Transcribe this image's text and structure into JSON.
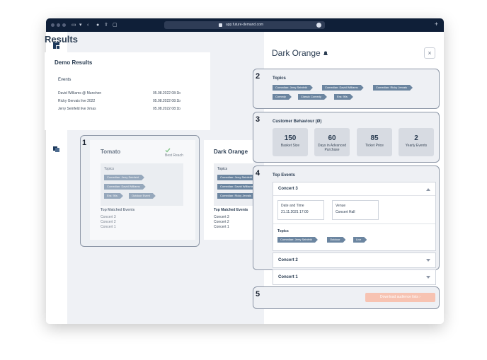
{
  "browser": {
    "url": "app.future-demand.com"
  },
  "sidebar": {
    "icons": [
      "brand-logo-icon",
      "home-icon",
      "checker-icon",
      "bar-chart-icon",
      "layers-icon"
    ]
  },
  "results": {
    "title": "Results",
    "demo": {
      "title": "Demo Results",
      "events_label": "Events",
      "events": [
        {
          "name": "David Williams @ Munchen",
          "date": "05.08.2022 08:1b"
        },
        {
          "name": "Ricky Gervais live 2022",
          "date": "05.08.2022 08:1b"
        },
        {
          "name": "Jerry Seinfeld live Xmas",
          "date": "05.08.2022 08:1b"
        }
      ]
    },
    "cards": [
      {
        "title": "Tomato",
        "badge": "Best Reach",
        "topics_label": "Topics",
        "topics": [
          "Comedian: Jerry Seinfeld",
          "Comedian: David Williams",
          "Era: 90s",
          "Outdoor Event"
        ],
        "tme_label": "Top Matched Events",
        "events": [
          "Concert 3",
          "Concert 2",
          "Concert 1"
        ]
      },
      {
        "title": "Dark Orange",
        "topics_label": "Topics",
        "topics": [
          "Comedian: Jerry Seinfeld",
          "Comedian: David Williams",
          "Comedian: Ricky Jervais"
        ],
        "tme_label": "Top Matched Events",
        "events": [
          "Concert 3",
          "Concert 2",
          "Concert 1"
        ]
      }
    ]
  },
  "callouts": [
    "1",
    "2",
    "3",
    "4",
    "5"
  ],
  "panel": {
    "title": "Dark Orange",
    "close_symbol": "×",
    "topics": {
      "title": "Topics",
      "tags": [
        "Comedian: Jerry Seinfeld",
        "Comedian: David Williams",
        "Comedian: Ricky Jervais",
        "Comedy",
        "Classic Comedy",
        "Era: 90s"
      ]
    },
    "behaviour": {
      "title": "Customer Behaviour (Ø)",
      "stats": [
        {
          "value": "150",
          "label": "Basket Size"
        },
        {
          "value": "60",
          "label": "Days in Advanced Purchase"
        },
        {
          "value": "85",
          "label": "Ticket Price"
        },
        {
          "value": "2",
          "label": "Yearly Events"
        }
      ]
    },
    "top_events": {
      "title": "Top Events",
      "expanded": {
        "name": "Concert 3",
        "date_label": "Date and Time",
        "date_value": "21.11.2021 17:00",
        "venue_label": "Venue",
        "venue_value": "Concert Hall",
        "topics_label": "Topics",
        "tags": [
          "Comedian: Jerry Seinfeld",
          "Outdoor",
          "Live"
        ]
      },
      "collapsed": [
        "Concert 2",
        "Concert 1"
      ]
    },
    "download_label": "Download audience lists"
  },
  "colors": {
    "titlebar": "#0f1f38",
    "tag": "#6b85a0",
    "download": "#f7c3b2"
  }
}
